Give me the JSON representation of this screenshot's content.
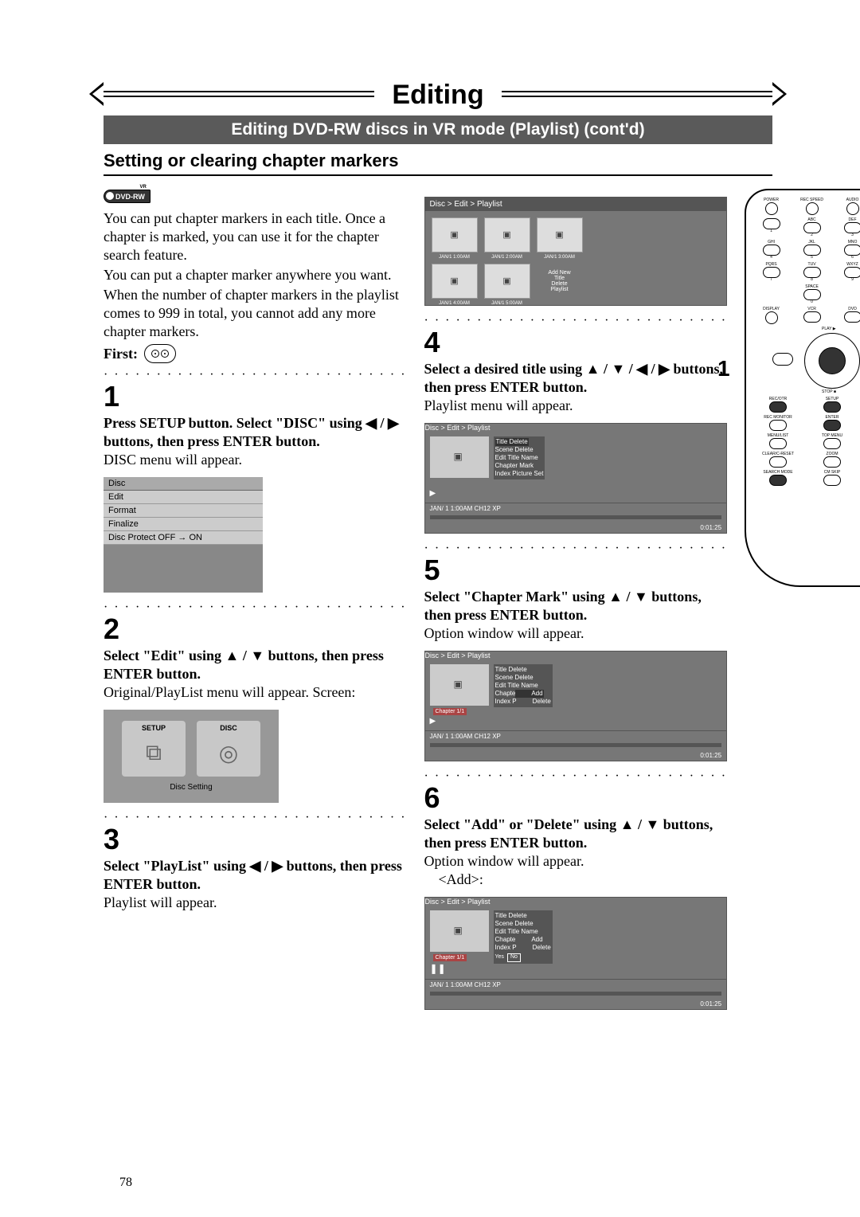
{
  "header": {
    "title": "Editing",
    "subtitle": "Editing DVD-RW discs in VR mode (Playlist) (cont'd)",
    "section": "Setting or clearing chapter markers"
  },
  "badge": {
    "main": "DVD-RW",
    "sup": "VR"
  },
  "intro": {
    "p1": "You can put chapter markers in each title. Once a chapter is marked, you can use it for the chapter search feature.",
    "p2": "You can put a chapter marker anywhere you want.",
    "p3": "When the number of chapter markers in the playlist comes to 999 in total, you cannot add any more chapter markers."
  },
  "first_label": "First:",
  "steps": {
    "s1": {
      "n": "1",
      "bold": "Press SETUP button. Select \"DISC\" using ◀ / ▶ buttons, then press ENTER button.",
      "reg": "DISC menu will appear."
    },
    "s2": {
      "n": "2",
      "bold": "Select \"Edit\" using ▲ / ▼ buttons, then press ENTER button.",
      "reg": "Original/PlayList menu will appear. Screen:"
    },
    "s3": {
      "n": "3",
      "bold": "Select \"PlayList\" using ◀ / ▶ buttons, then press ENTER button.",
      "reg": "Playlist will appear."
    },
    "s4": {
      "n": "4",
      "bold": "Select a desired title using ▲ / ▼ / ◀ / ▶ buttons, then press ENTER button.",
      "reg": "Playlist menu will appear."
    },
    "s5": {
      "n": "5",
      "bold": "Select \"Chapter Mark\" using ▲ / ▼ buttons, then press ENTER button.",
      "reg": "Option window will appear."
    },
    "s6": {
      "n": "6",
      "bold": "Select \"Add\" or \"Delete\" using ▲ / ▼ buttons, then press ENTER button.",
      "reg": "Option window will appear.",
      "extra": "<Add>:"
    }
  },
  "osd": {
    "breadcrumb": "Disc > Edit > Playlist",
    "thumbs": [
      "JAN/1  1:00AM",
      "JAN/1  2:00AM",
      "JAN/1  3:00AM",
      "JAN/1  4:00AM",
      "JAN/1  5:00AM"
    ],
    "addnew": [
      "Add New",
      "Title",
      "Delete",
      "Playlist"
    ],
    "disc_menu": {
      "hdr": "Disc",
      "items": [
        "Edit",
        "Format",
        "Finalize",
        "Disc Protect OFF → ON"
      ]
    },
    "setup": {
      "left": "SETUP",
      "right": "DISC",
      "caption": "Disc Setting"
    },
    "edit_menu": {
      "items": [
        "Title Delete",
        "Scene Delete",
        "Edit Title Name",
        "Chapter Mark",
        "Index Picture Set"
      ],
      "items2_pref": [
        "Title Delete",
        "Scene Delete",
        "Edit Title Name"
      ],
      "chapter_label": "Chapter 1/1",
      "chapter_mark_pref": "Chapte",
      "index_pref": "Index P",
      "add": "Add",
      "delete": "Delete",
      "yes": "Yes",
      "no": "No",
      "status_left": "JAN/ 1   1:00AM  CH12     XP",
      "status_right": "0:01:25"
    }
  },
  "remote_nums": [
    "1",
    "2",
    "3",
    "4",
    "5",
    "6"
  ],
  "callout1": "1",
  "page": "78"
}
